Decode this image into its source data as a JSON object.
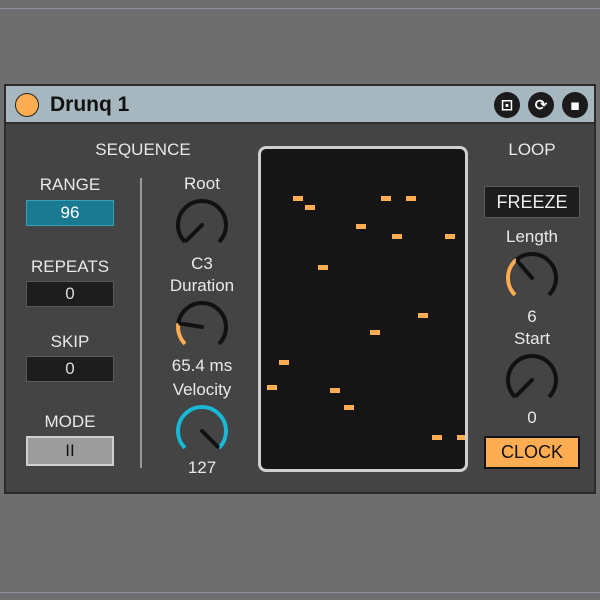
{
  "device": {
    "title": "Drunq 1"
  },
  "titlebar_icons": [
    {
      "name": "device-mode-icon",
      "glyph": "⊡"
    },
    {
      "name": "reload-icon",
      "glyph": "⟳"
    },
    {
      "name": "save-icon",
      "glyph": "▪"
    }
  ],
  "sequence": {
    "header": "SEQUENCE",
    "range": {
      "label": "RANGE",
      "value": "96"
    },
    "repeats": {
      "label": "REPEATS",
      "value": "0"
    },
    "skip": {
      "label": "SKIP",
      "value": "0"
    },
    "mode": {
      "label": "MODE",
      "value": "II"
    },
    "root": {
      "label": "Root",
      "value": "C3",
      "level": 0.0
    },
    "duration": {
      "label": "Duration",
      "value": "65.4 ms",
      "level": 0.2
    },
    "velocity": {
      "label": "Velocity",
      "value": "127",
      "level": 1.0
    }
  },
  "loop": {
    "header": "LOOP",
    "freeze_label": "FREEZE",
    "length": {
      "label": "Length",
      "value": "6",
      "level": 0.35
    },
    "start": {
      "label": "Start",
      "value": "0",
      "level": 0.0
    },
    "clock_label": "CLOCK"
  },
  "colors": {
    "accent_blue": "#1ab8d4",
    "accent_orange": "#ffad52"
  }
}
